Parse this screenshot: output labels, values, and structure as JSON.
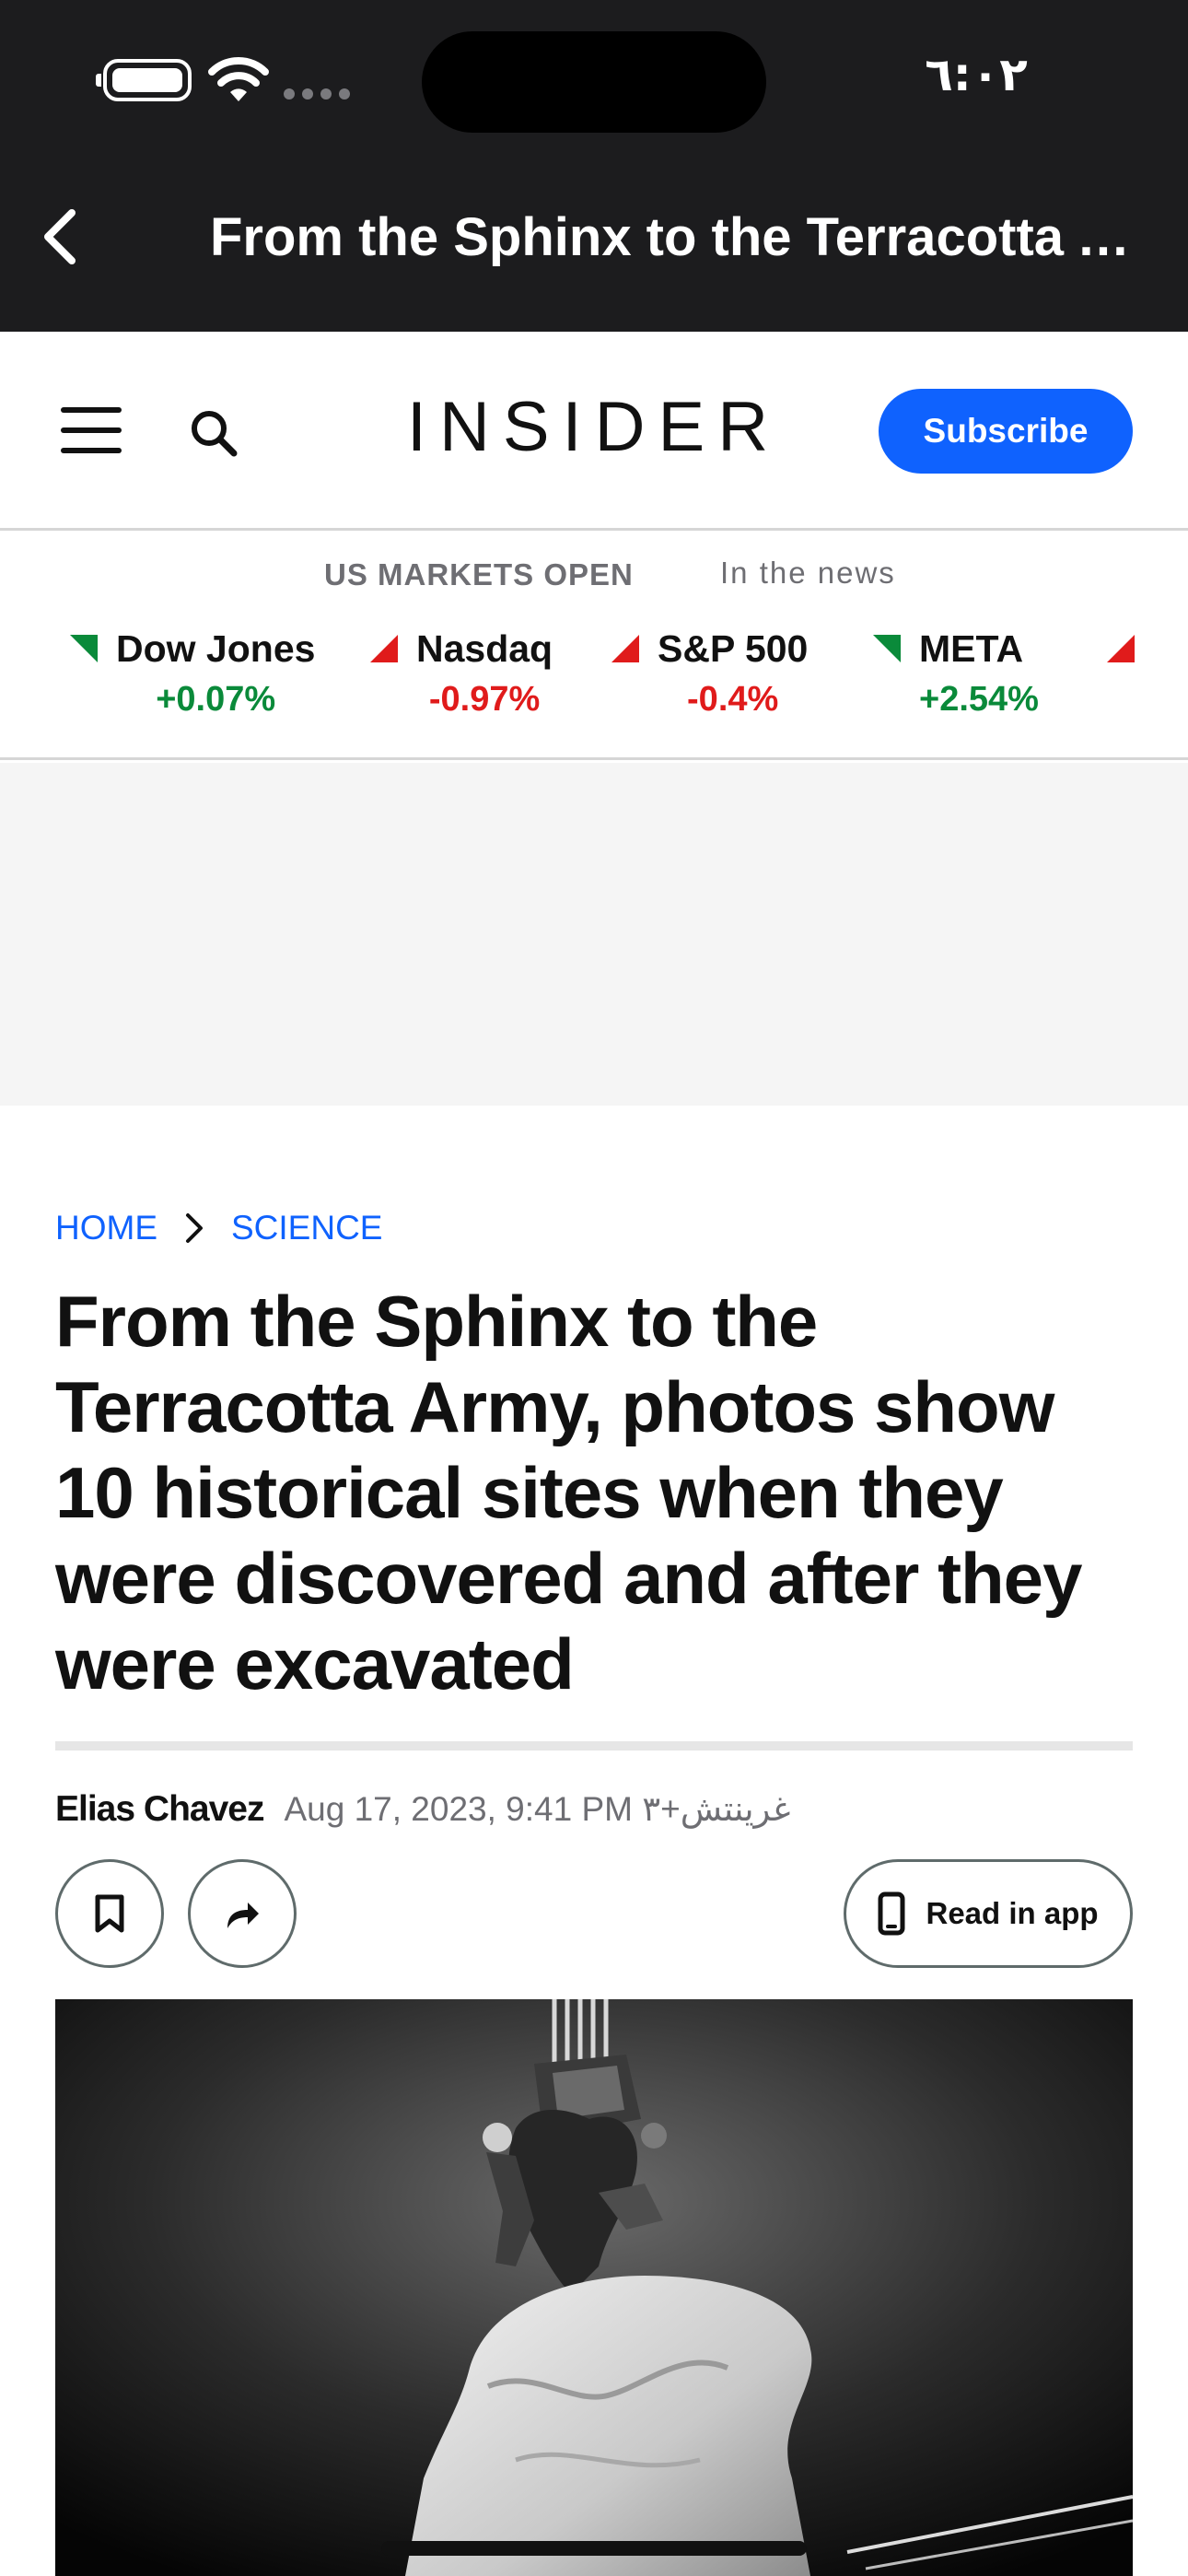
{
  "status_bar": {
    "time": "٦:٠٢",
    "icons": [
      "battery-icon",
      "wifi-icon",
      "cellular-signal-icon"
    ]
  },
  "nav_bar": {
    "back_icon": "chevron-left-icon",
    "title": "From the Sphinx to the Terracotta Army, photos show 10 historical sites when they were discovered and after they were excavated"
  },
  "site_header": {
    "menu_icon": "hamburger-menu-icon",
    "search_icon": "search-icon",
    "logo": "INSIDER",
    "subscribe_label": "Subscribe",
    "colors": {
      "subscribe_bg": "#0f62fe"
    }
  },
  "markets": {
    "status": "US MARKETS OPEN",
    "in_the_news": "In the news",
    "tickers": [
      {
        "name": "Dow Jones",
        "change": "+0.07%",
        "direction": "down-green"
      },
      {
        "name": "Nasdaq",
        "change": "-0.97%",
        "direction": "up-red"
      },
      {
        "name": "S&P 500",
        "change": "-0.4%",
        "direction": "up-red"
      },
      {
        "name": "META",
        "change": "+2.54%",
        "direction": "down-green"
      }
    ],
    "colors": {
      "positive": "#0a8a3a",
      "negative": "#e01b1b"
    }
  },
  "article": {
    "breadcrumb": {
      "home": "HOME",
      "section": "SCIENCE"
    },
    "headline": "From the Sphinx to the Terracotta Army, photos show 10 historical sites when they were discovered and after they were excavated",
    "author": "Elias Chavez",
    "date": "Aug 17, 2023, 9:41 PM غرينتش+٣",
    "bookmark_icon": "bookmark-icon",
    "share_icon": "share-icon",
    "read_in_app_label": "Read in app",
    "phone_icon": "phone-icon",
    "hero_image": "black-and-white photo of workers on a colossal statue head lifted by a crane"
  }
}
